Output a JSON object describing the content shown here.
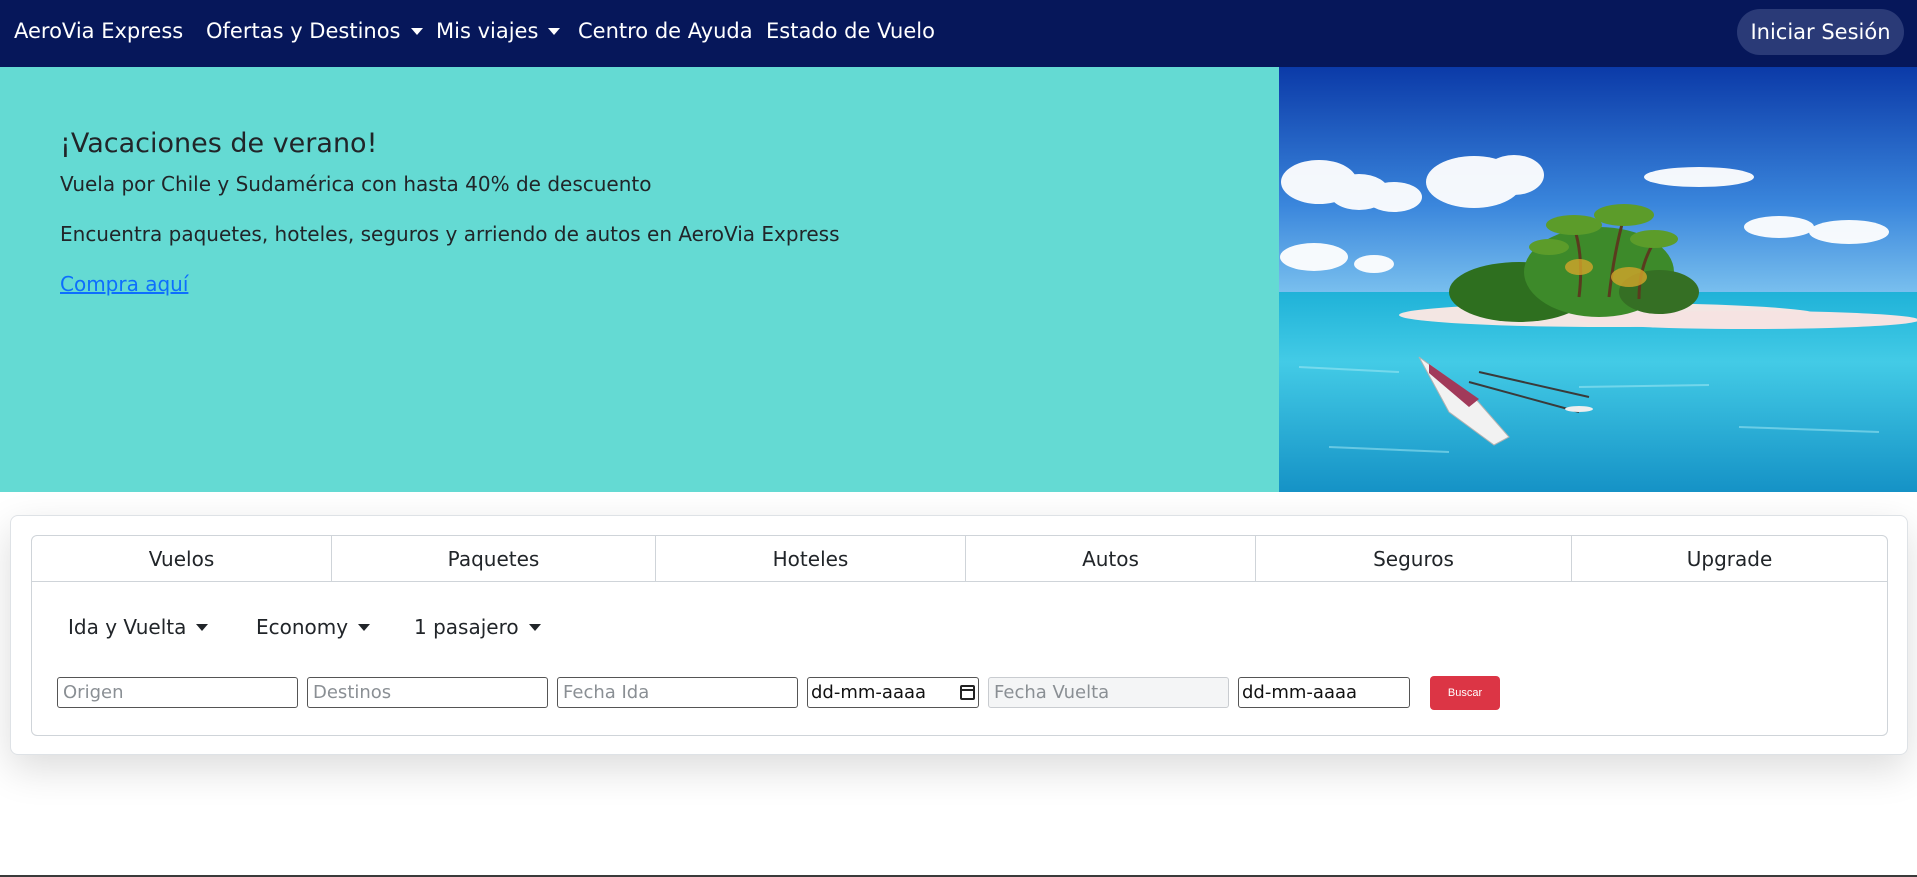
{
  "navbar": {
    "brand": "AeroVia Express",
    "items": [
      {
        "label": "Ofertas y Destinos",
        "dropdown": true
      },
      {
        "label": "Mis viajes",
        "dropdown": true
      },
      {
        "label": "Centro de Ayuda",
        "dropdown": false
      },
      {
        "label": "Estado de Vuelo",
        "dropdown": false
      }
    ],
    "login_label": "Iniciar Sesión"
  },
  "hero": {
    "title": "¡Vacaciones de verano!",
    "subtitle": "Vuela por Chile y Sudamérica con hasta 40% de descuento",
    "description": "Encuentra paquetes, hoteles, seguros y arriendo de autos en AeroVia Express",
    "link_label": "Compra aquí",
    "background_color": "#64dad3"
  },
  "search": {
    "tabs": [
      "Vuelos",
      "Paquetes",
      "Hoteles",
      "Autos",
      "Seguros",
      "Upgrade"
    ],
    "trip_type": "Ida y Vuelta",
    "cabin_class": "Economy",
    "passengers": "1 pasajero",
    "origin_placeholder": "Origen",
    "destination_placeholder": "Destinos",
    "depart_label_placeholder": "Fecha Ida",
    "depart_date": "dd-mm-aaaa",
    "return_label_placeholder": "Fecha Vuelta",
    "return_date": "dd-mm-aaaa",
    "search_label": "Buscar"
  },
  "colors": {
    "navbar": "#06175a",
    "accent_button": "#dc3545",
    "link": "#0d6efd"
  }
}
